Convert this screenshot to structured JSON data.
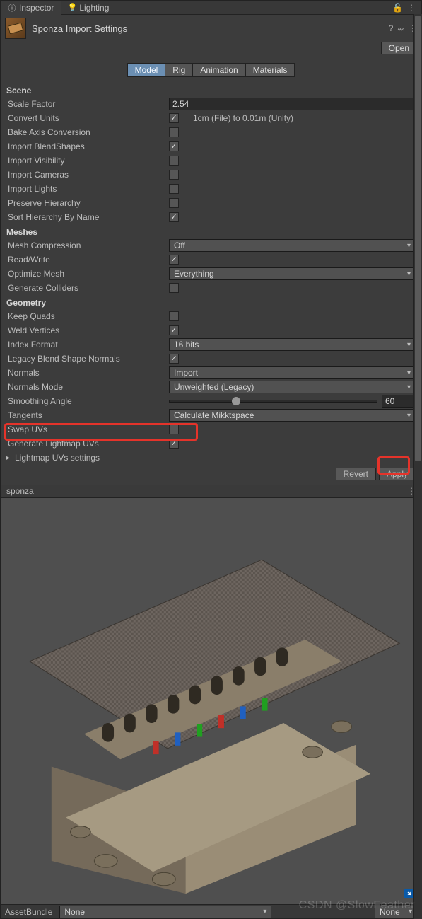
{
  "tabs": {
    "inspector": "Inspector",
    "lighting": "Lighting"
  },
  "header": {
    "title": "Sponza Import Settings",
    "open": "Open"
  },
  "innerTabs": {
    "model": "Model",
    "rig": "Rig",
    "animation": "Animation",
    "materials": "Materials"
  },
  "sections": {
    "scene": "Scene",
    "meshes": "Meshes",
    "geometry": "Geometry"
  },
  "labels": {
    "scaleFactor": "Scale Factor",
    "convertUnits": "Convert Units",
    "convertUnitsInfo": "1cm (File) to 0.01m (Unity)",
    "bakeAxis": "Bake Axis Conversion",
    "importBlend": "Import BlendShapes",
    "importVis": "Import Visibility",
    "importCam": "Import Cameras",
    "importLight": "Import Lights",
    "preserveHier": "Preserve Hierarchy",
    "sortHier": "Sort Hierarchy By Name",
    "meshComp": "Mesh Compression",
    "readWrite": "Read/Write",
    "optimizeMesh": "Optimize Mesh",
    "genColliders": "Generate Colliders",
    "keepQuads": "Keep Quads",
    "weldVerts": "Weld Vertices",
    "indexFormat": "Index Format",
    "legacyBlend": "Legacy Blend Shape Normals",
    "normals": "Normals",
    "normalsMode": "Normals Mode",
    "smoothAngle": "Smoothing Angle",
    "tangents": "Tangents",
    "swapUVs": "Swap UVs",
    "genLightmap": "Generate Lightmap UVs",
    "lmSettings": "Lightmap UVs settings"
  },
  "values": {
    "scaleFactor": "2.54",
    "meshComp": "Off",
    "optimizeMesh": "Everything",
    "indexFormat": "16 bits",
    "normals": "Import",
    "normalsMode": "Unweighted (Legacy)",
    "smoothAngle": "60",
    "tangents": "Calculate Mikktspace"
  },
  "buttons": {
    "revert": "Revert",
    "apply": "Apply"
  },
  "preview": {
    "name": "sponza"
  },
  "assetBundle": {
    "label": "AssetBundle",
    "value": "None",
    "variant": "None"
  },
  "watermark": "CSDN @SlowFeather"
}
